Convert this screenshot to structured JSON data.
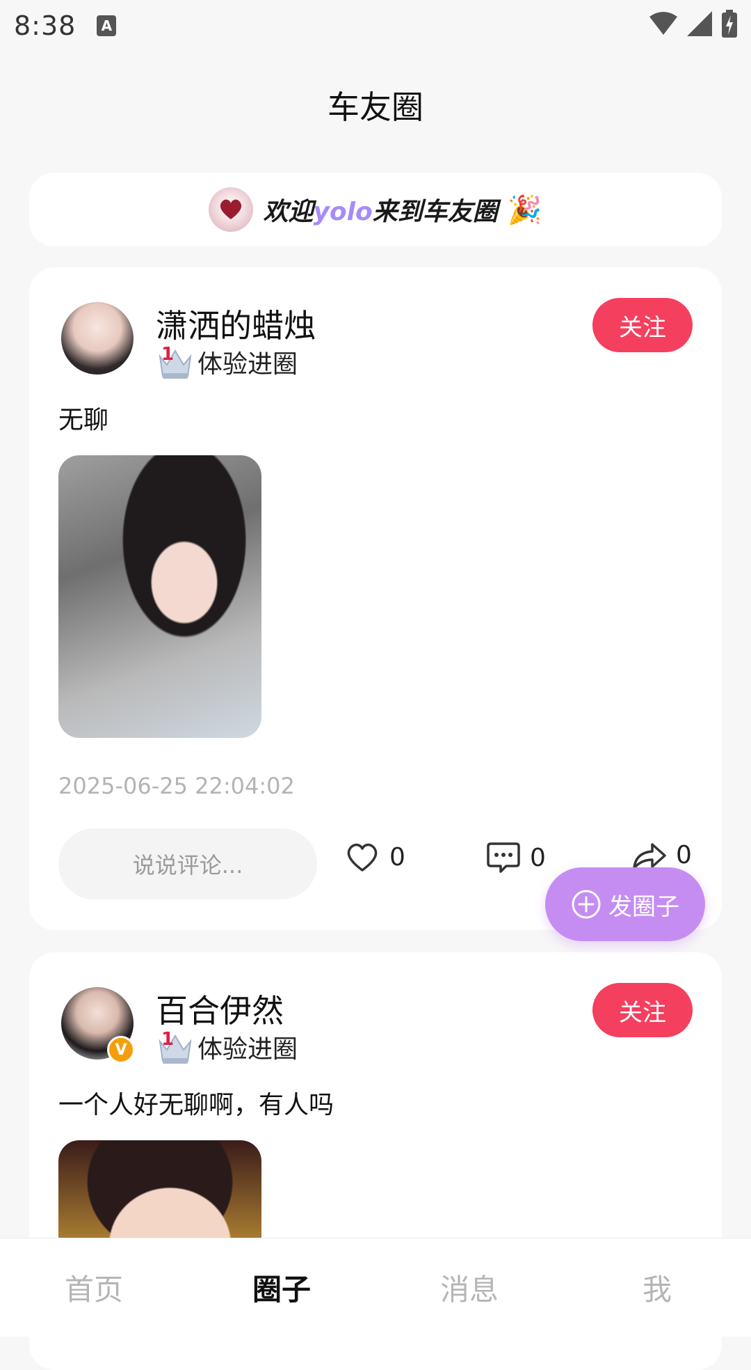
{
  "status_bar": {
    "time": "8:38",
    "a_icon": "A"
  },
  "header": {
    "title": "车友圈"
  },
  "banner": {
    "prefix": "欢迎",
    "name": "yolo",
    "suffix": "来到车友圈"
  },
  "posts": [
    {
      "username": "潇洒的蜡烛",
      "level_num": "1",
      "level_label": "体验进圈",
      "follow_label": "关注",
      "text": "无聊",
      "timestamp": "2025-06-25 22:04:02",
      "comment_placeholder": "说说评论...",
      "likes": "0",
      "comments": "0",
      "shares": "0"
    },
    {
      "username": "百合伊然",
      "verified": "V",
      "level_num": "1",
      "level_label": "体验进圈",
      "follow_label": "关注",
      "text": "一个人好无聊啊，有人吗"
    }
  ],
  "fab": {
    "label": "发圈子"
  },
  "bottom_nav": [
    {
      "label": "首页"
    },
    {
      "label": "圈子"
    },
    {
      "label": "消息"
    },
    {
      "label": "我"
    }
  ]
}
